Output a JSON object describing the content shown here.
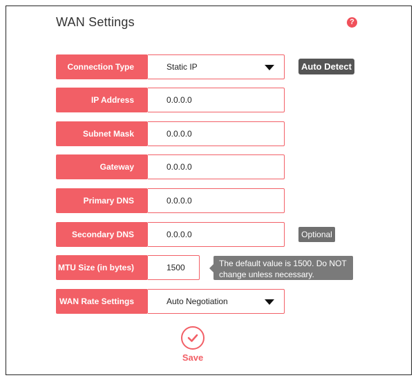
{
  "page": {
    "title": "WAN Settings",
    "help_icon": "question-mark-icon",
    "accent_color": "#f25f66"
  },
  "form": {
    "connection_type": {
      "label": "Connection Type",
      "value": "Static IP",
      "auto_detect_label": "Auto Detect"
    },
    "ip_address": {
      "label": "IP Address",
      "value": "0.0.0.0"
    },
    "subnet_mask": {
      "label": "Subnet Mask",
      "value": "0.0.0.0"
    },
    "gateway": {
      "label": "Gateway",
      "value": "0.0.0.0"
    },
    "primary_dns": {
      "label": "Primary DNS",
      "value": "0.0.0.0"
    },
    "secondary_dns": {
      "label": "Secondary DNS",
      "value": "0.0.0.0",
      "optional_label": "Optional"
    },
    "mtu": {
      "label": "MTU Size (in bytes)",
      "value": "1500",
      "note": "The default value is 1500. Do NOT change unless necessary."
    },
    "wan_rate": {
      "label": "WAN Rate Settings",
      "value": "Auto Negotiation"
    }
  },
  "actions": {
    "save_label": "Save",
    "save_icon": "checkmark-icon"
  }
}
